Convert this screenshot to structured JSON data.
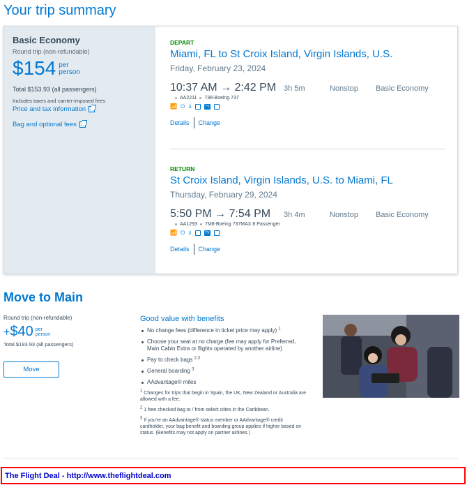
{
  "page_title": "Your trip summary",
  "fare": {
    "name": "Basic Economy",
    "subtitle": "Round trip (non-refundable)",
    "price": "$154",
    "per_line1": "per",
    "per_line2": "person",
    "total": "Total $153.93 (all passengers)",
    "includes": "Includes taxes and carrier-imposed fees",
    "price_tax_link": "Price and tax information",
    "bag_link": "Bag and optional fees"
  },
  "depart": {
    "label": "DEPART",
    "route": "Miami, FL to St Croix Island, Virgin Islands, U.S.",
    "date": "Friday, February 23, 2024",
    "times": "10:37 AM  →  2:42 PM",
    "duration": "3h 5m",
    "stops": "Nonstop",
    "cabin": "Basic Economy",
    "flight_number": "AA2211",
    "aircraft": "738-Boeing 737",
    "details_link": "Details",
    "change_link": "Change"
  },
  "return": {
    "label": "RETURN",
    "route": "St Croix Island, Virgin Islands, U.S. to Miami, FL",
    "date": "Thursday, February 29, 2024",
    "times": "5:50 PM  →  7:54 PM",
    "duration": "3h 4m",
    "stops": "Nonstop",
    "cabin": "Basic Economy",
    "flight_number": "AA1293",
    "aircraft": "7M8-Boeing 737MAX 8 Passenger",
    "details_link": "Details",
    "change_link": "Change"
  },
  "amenity_icons": [
    "wifi-icon",
    "power-icon",
    "usb-icon",
    "phone-entertainment-icon",
    "tv-icon",
    "entertainment-app-icon"
  ],
  "move_to_main": {
    "title": "Move to Main",
    "subtitle": "Round trip (non-refundable)",
    "plus": "+",
    "price": "$40",
    "per_line1": "per",
    "per_line2": "person",
    "total": "Total $193.93 (all passengers)",
    "button_label": "Move",
    "benefits_title": "Good value with benefits",
    "benefits": [
      {
        "text": "No change fees (difference in ticket price may apply)",
        "sup": "1"
      },
      {
        "text": "Choose your seat at no charge (fee may apply for Preferred, Main Cabin Extra or flights operated by another airline)",
        "sup": ""
      },
      {
        "text": "Pay to check bags",
        "sup": "2,3"
      },
      {
        "text": "General boarding",
        "sup": "3"
      },
      {
        "text": "AAdvantage® miles",
        "sup": ""
      }
    ],
    "notes": [
      {
        "sup": "1",
        "text": "Changes for trips that begin in Spain, the UK, New Zealand or Australia are allowed with a fee."
      },
      {
        "sup": "2",
        "text": "1 free checked bag to / from select cities in the Caribbean."
      },
      {
        "sup": "3",
        "text": "If you're an AAdvantage® status member or AAdvantage® credit cardholder, your bag benefit and boarding group applies if higher based on status. (Benefits may not apply on partner airlines.)"
      }
    ]
  },
  "footer_banner": "The Flight Deal - http://www.theflightdeal.com",
  "colors": {
    "brand_blue": "#0078d2",
    "green_label": "#008a00",
    "panel_gray": "#e4ebf0",
    "banner_red": "#ff0000"
  }
}
